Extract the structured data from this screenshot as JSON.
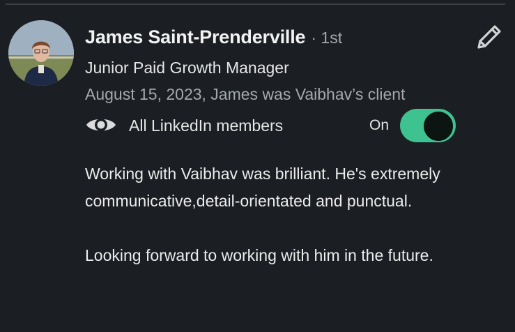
{
  "recommendation": {
    "author_name": "James Saint-Prenderville",
    "connection_degree": "· 1st",
    "headline": "Junior Paid Growth Manager",
    "meta": "August 15, 2023, James was Vaibhav’s client",
    "visibility": {
      "label": "All LinkedIn members",
      "toggle_label": "On",
      "toggle_on": true
    },
    "paragraphs": [
      "Working with Vaibhav was brilliant. He's extremely communicative,detail-orientated and punctual.",
      "Looking forward to working with him in the future."
    ]
  },
  "icons": {
    "edit": "pencil-icon",
    "visibility": "eye-icon"
  },
  "colors": {
    "background": "#1b1f23",
    "toggle_on": "#3ec28f",
    "muted_text": "#a4a9ae"
  }
}
